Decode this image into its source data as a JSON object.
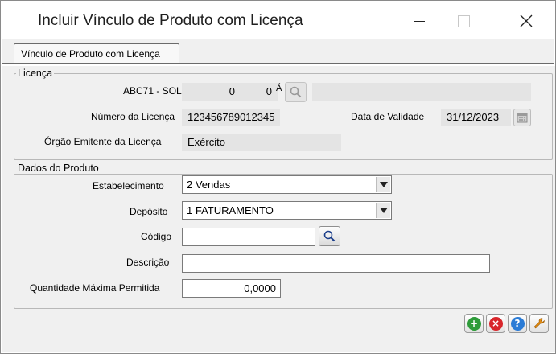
{
  "window": {
    "title": "Incluir Vínculo de Produto com Licença",
    "minimize_icon": "minimize-icon",
    "maximize_icon": "maximize-icon",
    "close_icon": "close-icon"
  },
  "tabs": [
    {
      "label": "Vínculo de Produto com Licença",
      "active": true
    }
  ],
  "licenca": {
    "legend": "Licença",
    "code_label": "ABC71 - SOL",
    "field_a": "0",
    "field_b": "0",
    "overlap_label": "Á",
    "description": "",
    "numero_label": "Número da Licença",
    "numero_value": "123456789012345",
    "validade_label": "Data de Validade",
    "validade_value": "31/12/2023",
    "orgao_label": "Órgão Emitente da Licença",
    "orgao_value": "Exército"
  },
  "produto": {
    "legend": "Dados do Produto",
    "estabelecimento_label": "Estabelecimento",
    "estabelecimento_value": "2 Vendas",
    "deposito_label": "Depósito",
    "deposito_value": "1 FATURAMENTO",
    "codigo_label": "Código",
    "codigo_value": "",
    "descricao_label": "Descrição",
    "descricao_value": "",
    "quantidade_label": "Quantidade Máxima Permitida",
    "quantidade_value": "0,0000"
  },
  "actions": {
    "confirm_icon": "confirm-add-icon",
    "cancel_icon": "cancel-icon",
    "help_icon": "help-icon",
    "tools_icon": "wrench-icon"
  },
  "colors": {
    "confirm": "#2e9c3a",
    "cancel": "#d8262b",
    "help": "#2a7bd6",
    "tools": "#e08a12"
  }
}
